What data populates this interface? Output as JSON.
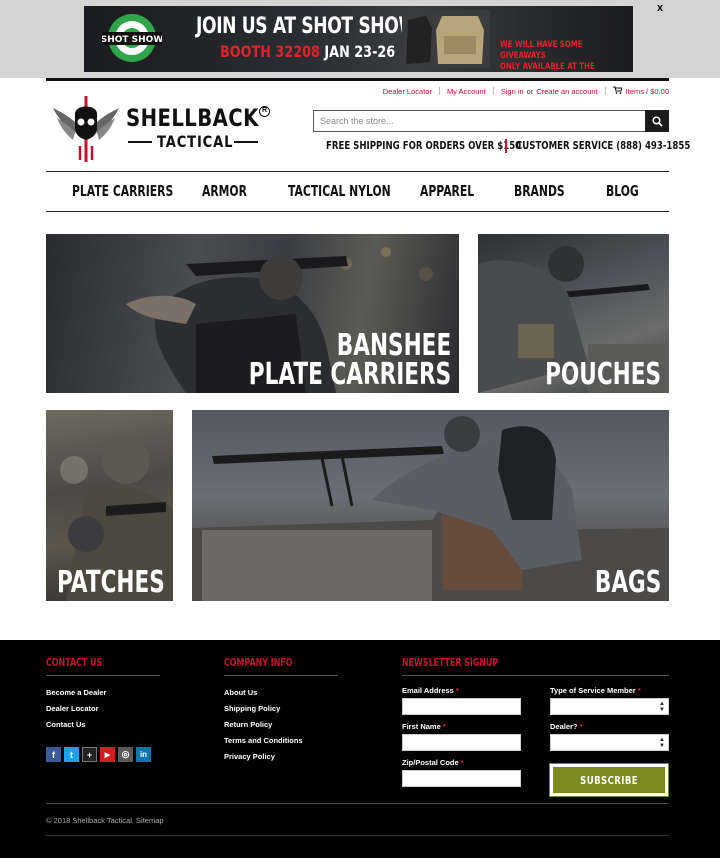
{
  "promo": {
    "logo_text": "SHOT SHOW",
    "headline": "JOIN US AT SHOT SHOW!",
    "booth": "BOOTH 32208",
    "dates": "JAN 23-26",
    "giveaway_line1": "WE WILL HAVE SOME GIVEAWAYS",
    "giveaway_line2": "ONLY AVAILABLE AT THE SHOW.",
    "close_label": "x"
  },
  "utility_nav": {
    "dealer_locator": "Dealer Locator",
    "my_account": "My Account",
    "sign_in": "Sign in",
    "or": "or",
    "create_account": "Create an account",
    "cart": "Items / $0.00"
  },
  "brand": {
    "name": "SHELLBACK",
    "reg": "R",
    "sub": "TACTICAL"
  },
  "search": {
    "placeholder": "Search the store..."
  },
  "info_bar": {
    "shipping": "FREE SHIPPING FOR ORDERS OVER $150",
    "service": "CUSTOMER SERVICE (888) 493-1855"
  },
  "main_nav": {
    "items": [
      "PLATE CARRIERS",
      "ARMOR",
      "TACTICAL NYLON",
      "APPAREL",
      "BRANDS",
      "BLOG"
    ]
  },
  "tiles": {
    "plate_line1": "BANSHEE",
    "plate_line2": "PLATE CARRIERS",
    "pouches": "POUCHES",
    "patches": "PATCHES",
    "bags": "BAGS"
  },
  "footer": {
    "contact_heading": "CONTACT US",
    "contact_links": [
      "Become a Dealer",
      "Dealer Locator",
      "Contact Us"
    ],
    "company_heading": "COMPANY INFO",
    "company_links": [
      "About Us",
      "Shipping Policy",
      "Return Policy",
      "Terms and Conditions",
      "Privacy Policy"
    ],
    "newsletter_heading": "NEWSLETTER SIGNUP",
    "email_label": "Email Address",
    "first_name_label": "First Name",
    "zip_label": "Zip/Postal Code",
    "service_label": "Type of Service Member",
    "dealer_label": "Dealer?",
    "required_mark": "*",
    "subscribe": "SUBSCRIBE",
    "copyright": "© 2018 Shellback Tactical. Sitemap"
  },
  "social": [
    {
      "name": "facebook",
      "glyph": "f",
      "color": "#3b5998"
    },
    {
      "name": "twitter",
      "glyph": "t",
      "color": "#1da1f2"
    },
    {
      "name": "google-plus",
      "glyph": "+",
      "color": "#222222"
    },
    {
      "name": "youtube",
      "glyph": "▶",
      "color": "#cd201f"
    },
    {
      "name": "instagram",
      "glyph": "◎",
      "color": "#5a5a5a"
    },
    {
      "name": "linkedin",
      "glyph": "in",
      "color": "#0e76a8"
    }
  ],
  "colors": {
    "accent_red": "#c8102e",
    "subscribe_green": "#7b8a1f",
    "footer_bg": "#020202"
  }
}
